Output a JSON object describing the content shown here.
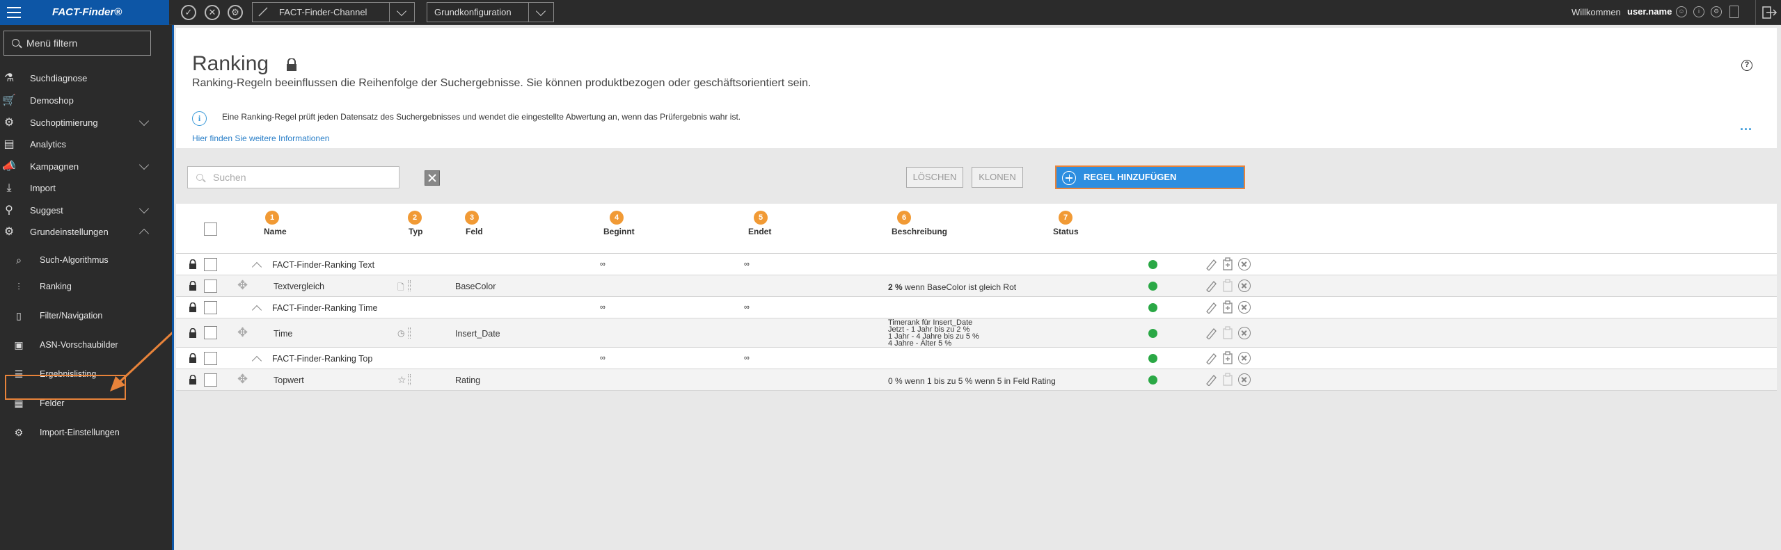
{
  "topbar": {
    "app_title": "FACT-Finder®",
    "channel": "FACT-Finder-Channel",
    "config": "Grundkonfiguration",
    "welcome": "Willkommen",
    "username": "user.name"
  },
  "sidebar": {
    "filter_label": "Menü filtern",
    "items": [
      {
        "label": "Suchdiagnose",
        "icon": "flask-icon"
      },
      {
        "label": "Demoshop",
        "icon": "cart-icon"
      },
      {
        "label": "Suchoptimierung",
        "icon": "gear-search-icon"
      },
      {
        "label": "Analytics",
        "icon": "presentation-icon"
      },
      {
        "label": "Kampagnen",
        "icon": "megaphone-icon"
      },
      {
        "label": "Import",
        "icon": "download-icon"
      },
      {
        "label": "Suggest",
        "icon": "suggest-icon"
      },
      {
        "label": "Grundeinstellungen",
        "icon": "gear-icon"
      }
    ],
    "subitems": [
      {
        "label": "Such-Algorithmus",
        "icon": "algorithm-icon"
      },
      {
        "label": "Ranking",
        "icon": "sliders-icon"
      },
      {
        "label": "Filter/Navigation",
        "icon": "filter-icon"
      },
      {
        "label": "ASN-Vorschaubilder",
        "icon": "image-icon"
      },
      {
        "label": "Ergebnislisting",
        "icon": "list-icon"
      },
      {
        "label": "Felder",
        "icon": "fields-icon"
      },
      {
        "label": "Import-Einstellungen",
        "icon": "import-settings-icon"
      }
    ]
  },
  "page": {
    "title": "Ranking",
    "subtitle": "Ranking-Regeln beeinflussen die Reihenfolge der Suchergebnisse. Sie können produktbezogen oder geschäftsorientiert sein.",
    "info_text": "Eine Ranking-Regel prüft jeden Datensatz des Suchergebnisses und wendet die eingestellte Abwertung an, wenn das Prüfergebnis wahr ist.",
    "info_link": "Hier finden Sie weitere Informationen",
    "more": "...",
    "help": "?"
  },
  "toolbar": {
    "search_placeholder": "Suchen",
    "delete_label": "LÖSCHEN",
    "clone_label": "KLONEN",
    "add_label": "REGEL HINZUFÜGEN"
  },
  "table": {
    "columns": [
      {
        "num": "1",
        "label": "Name"
      },
      {
        "num": "2",
        "label": "Typ"
      },
      {
        "num": "3",
        "label": "Feld"
      },
      {
        "num": "4",
        "label": "Beginnt"
      },
      {
        "num": "5",
        "label": "Endet"
      },
      {
        "num": "6",
        "label": "Beschreibung"
      },
      {
        "num": "7",
        "label": "Status"
      }
    ],
    "rows": [
      {
        "name": "FACT-Finder-Ranking Text",
        "begins": "∞",
        "ends": "∞"
      },
      {
        "name": "Textvergleich",
        "field": "BaseColor",
        "desc_bold": "2 %",
        "desc": " wenn BaseColor ist gleich Rot"
      },
      {
        "name": "FACT-Finder-Ranking Time",
        "begins": "∞",
        "ends": "∞"
      },
      {
        "name": "Time",
        "field": "Insert_Date",
        "desc_lines": [
          "Timerank für Insert_Date",
          "Jetzt - 1 Jahr bis zu 2 %",
          "1 Jahr - 4 Jahre bis zu 5 %",
          "4 Jahre - Älter 5 %"
        ]
      },
      {
        "name": "FACT-Finder-Ranking Top",
        "begins": "∞",
        "ends": "∞"
      },
      {
        "name": "Topwert",
        "field": "Rating",
        "desc": "0 % wenn 1 bis zu 5 % wenn 5 in Feld Rating"
      }
    ]
  },
  "colors": {
    "accent": "#0d56a6",
    "button": "#2d8ee0",
    "highlight": "#e8833a",
    "badge": "#f19a35",
    "status_active": "#2aa845"
  }
}
